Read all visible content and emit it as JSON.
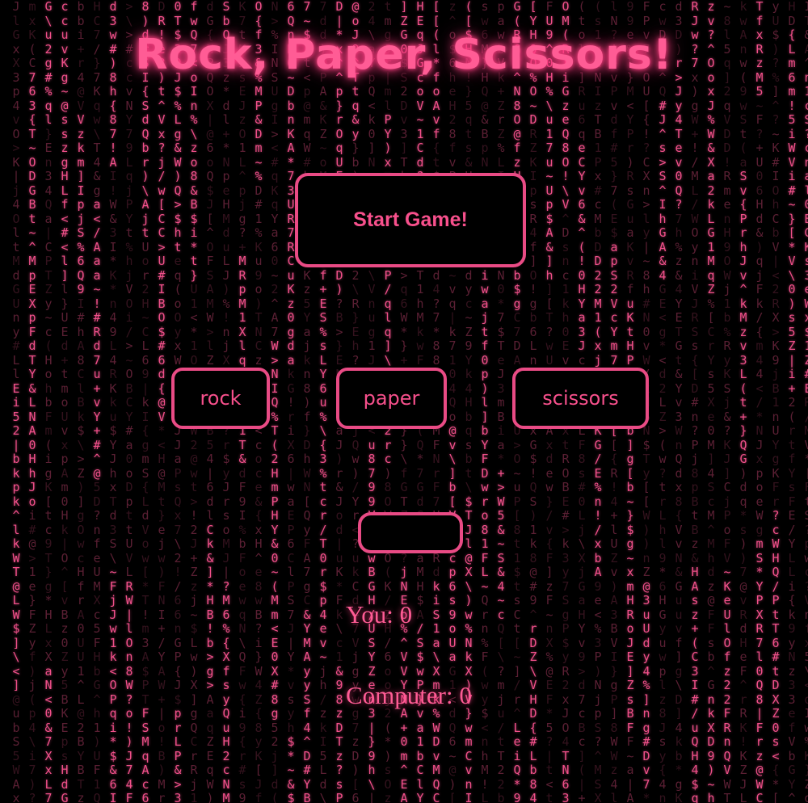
{
  "game": {
    "title": "Rock, Paper, Scissors!",
    "start_label": "Start Game!",
    "choices": {
      "rock": "rock",
      "paper": "paper",
      "scissors": "scissors"
    },
    "result": "",
    "score": {
      "you_label": "You:",
      "you_value": "0",
      "computer_label": "Computer:",
      "computer_value": "0"
    }
  },
  "theme": {
    "accent": "#f7508c",
    "border": "#e94b85",
    "background": "#000000"
  }
}
